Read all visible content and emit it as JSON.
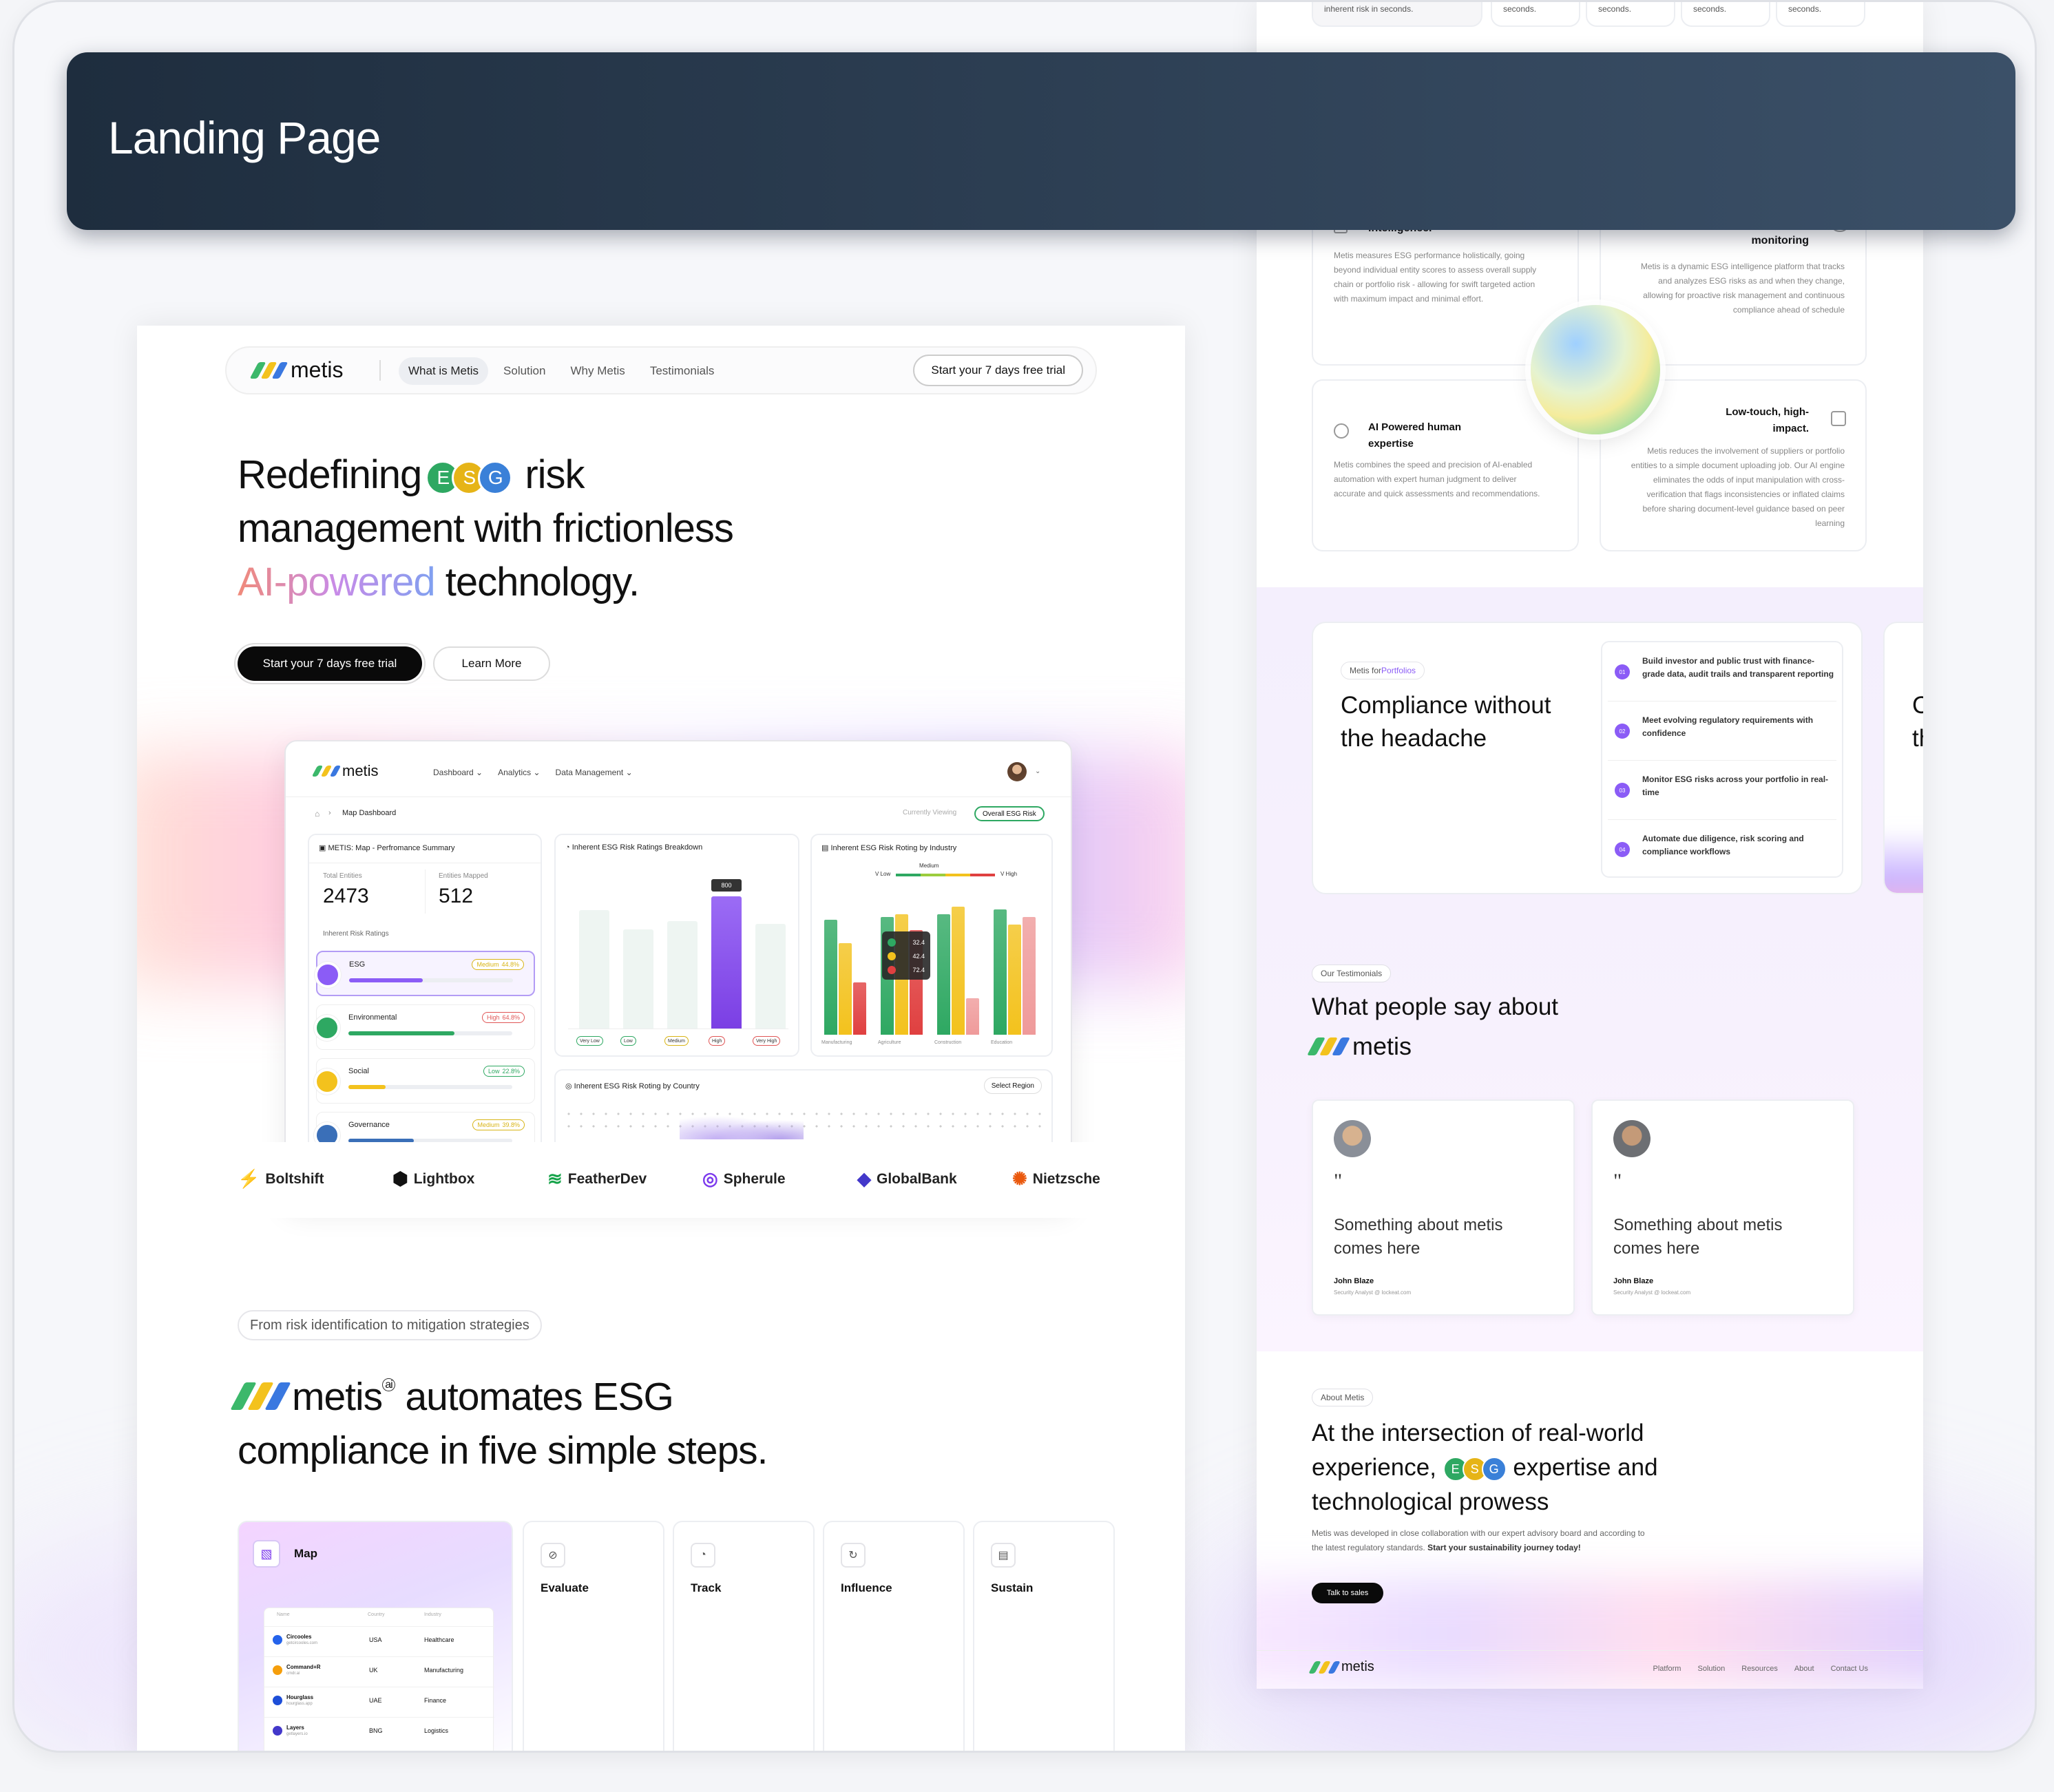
{
  "section_title": "Landing Page",
  "brand": {
    "name": "metis"
  },
  "colors": {
    "logo_green": "#3cb86b",
    "logo_yellow": "#f3c21d",
    "logo_blue": "#3a78e0",
    "esg_e": "#2ea862",
    "esg_s": "#e6b417",
    "esg_g": "#3a80d8",
    "purple": "#8b5cf6",
    "dark": "#0a0a0a"
  },
  "nav": {
    "items": [
      "What is Metis",
      "Solution",
      "Why Metis",
      "Testimonials"
    ],
    "cta": "Start your 7 days free trial"
  },
  "hero": {
    "line1_a": "Redefining",
    "line1_b": "risk",
    "line2": "management with frictionless",
    "line3_gradient": "AI-powered",
    "line3_rest": " technology.",
    "esg_letters": [
      "E",
      "S",
      "G"
    ],
    "cta_primary": "Start your 7 days free trial",
    "cta_secondary": "Learn More"
  },
  "dashboard": {
    "menus": [
      "Dashboard",
      "Analytics",
      "Data Management"
    ],
    "breadcrumb": "Map Dashboard",
    "currently_viewing": "Currently Viewing",
    "view_badge": "Overall ESG Risk",
    "summary_title": "METIS: Map - Perfromance Summary",
    "total_label": "Total Entities",
    "total_value": "2473",
    "mapped_label": "Entities Mapped",
    "mapped_value": "512",
    "ratings_label": "Inherent Risk Ratings",
    "risks": [
      {
        "name": "ESG",
        "level": "Medium",
        "pct": "44.8%",
        "fill": 0.448,
        "color": "#8b5cf6",
        "badge": "#d8b415"
      },
      {
        "name": "Environmental",
        "level": "High",
        "pct": "64.8%",
        "fill": 0.648,
        "color": "#2ea862",
        "badge": "#e05555"
      },
      {
        "name": "Social",
        "level": "Low",
        "pct": "22.8%",
        "fill": 0.228,
        "color": "#f3c21d",
        "badge": "#2ea862"
      },
      {
        "name": "Governance",
        "level": "Medium",
        "pct": "39.8%",
        "fill": 0.398,
        "color": "#3a6fb8",
        "badge": "#d8b415"
      }
    ],
    "breakdown_title": "Inherent ESG Risk Ratings Breakdown",
    "breakdown_tooltip": "800",
    "breakdown_labels": [
      "Very Low",
      "Low",
      "Medium",
      "High",
      "Very High"
    ],
    "industry_title": "Inherent ESG Risk Roting by Industry",
    "industry_legend": [
      "V Low",
      "Medium",
      "V High"
    ],
    "industry_tooltip": [
      "32.4",
      "42.4",
      "72.4"
    ],
    "industries": [
      "Manufacturing",
      "Agriculture",
      "Construction",
      "Education"
    ],
    "country_title": "Inherent ESG Risk Roting by Country",
    "select_region": "Select Region"
  },
  "partners": [
    "Boltshift",
    "Lightbox",
    "FeatherDev",
    "Spherule",
    "GlobalBank",
    "Nietzsche"
  ],
  "steps_section": {
    "badge": "From risk identification to mitigation strategies",
    "title_rest": " automates ESG",
    "title_line2": "compliance in five simple steps.",
    "steps": [
      "Map",
      "Evaluate",
      "Track",
      "Influence",
      "Sustain"
    ],
    "table_headers": [
      "Name",
      "Country",
      "Industry"
    ],
    "table_rows": [
      {
        "name": "Circooles",
        "sub": "getcircooles.com",
        "country": "USA",
        "industry": "Healthcare"
      },
      {
        "name": "Command+R",
        "sub": "cmdr.ai",
        "country": "UK",
        "industry": "Manufacturing"
      },
      {
        "name": "Hourglass",
        "sub": "hourglass.app",
        "country": "UAE",
        "industry": "Finance"
      },
      {
        "name": "Layers",
        "sub": "getlayers.io",
        "country": "BNG",
        "industry": "Logistics"
      }
    ]
  },
  "right_page": {
    "top_strip": [
      "inherent risk in seconds.",
      "seconds.",
      "seconds.",
      "seconds.",
      "seconds."
    ],
    "features": [
      {
        "title": "intelligence.",
        "text": "Metis measures ESG performance holistically, going beyond individual entity scores to assess overall supply chain or portfolio risk - allowing for swift targeted action with maximum impact and minimal effort."
      },
      {
        "title": "monitoring",
        "text": "Metis is a dynamic ESG intelligence platform that tracks and analyzes ESG risks as and when they change, allowing for proactive risk management and continuous compliance ahead of schedule"
      },
      {
        "title": "AI Powered human expertise",
        "text": "Metis combines the speed and precision of AI-enabled automation with expert human judgment to deliver accurate and quick assessments and recommendations."
      },
      {
        "title": "Low-touch, high-impact.",
        "text": "Metis reduces the involvement of suppliers or portfolio entities to a simple document uploading job. Our AI engine eliminates the odds of input manipulation with cross-verification that flags inconsistencies or inflated claims before sharing document-level guidance based on peer learning"
      }
    ],
    "portfolio": {
      "badge_a": "Metis for ",
      "badge_b": "Portfolios",
      "title": "Compliance without the headache",
      "items": [
        {
          "num": "01",
          "text": "Build investor and public trust with finance-grade data, audit trails and transparent reporting"
        },
        {
          "num": "02",
          "text": "Meet evolving regulatory requirements with confidence"
        },
        {
          "num": "03",
          "text": "Monitor ESG risks across your portfolio in real-time"
        },
        {
          "num": "04",
          "text": "Automate due diligence, risk scoring and compliance workflows"
        }
      ],
      "peek": "C th"
    },
    "testimonials": {
      "badge": "Our Testimonials",
      "title": "What people say about",
      "cards": [
        {
          "quote": "Something about metis comes here",
          "name": "John Blaze",
          "role": "Security Analyst @ lockeat.com"
        },
        {
          "quote": "Something about metis comes here",
          "name": "John Blaze",
          "role": "Security Analyst @ lockeat.com"
        }
      ]
    },
    "about": {
      "badge": "About Metis",
      "line1": "At the intersection of real-world",
      "line2_a": "experience,",
      "line2_b": "expertise and",
      "line3": "technological prowess",
      "body": "Metis was developed in close collaboration with our expert advisory board and according to the latest regulatory standards. ",
      "body_bold": "Start your sustainability journey today!",
      "cta": "Talk to sales"
    },
    "footer": [
      "Platform",
      "Solution",
      "Resources",
      "About",
      "Contact Us"
    ]
  }
}
